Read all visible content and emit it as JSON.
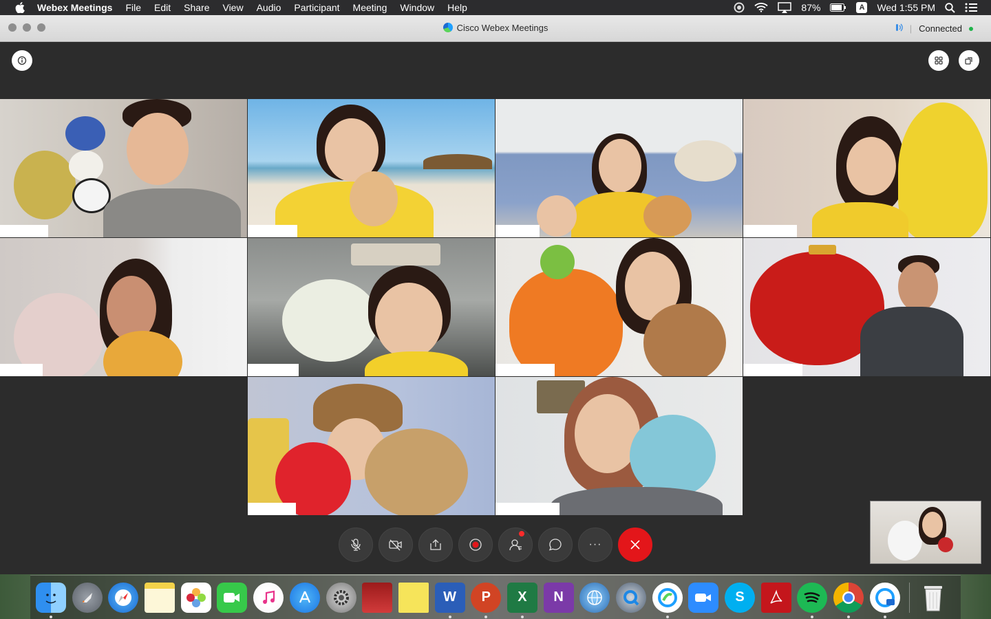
{
  "menubar": {
    "app_name": "Webex Meetings",
    "items": [
      "File",
      "Edit",
      "Share",
      "View",
      "Audio",
      "Participant",
      "Meeting",
      "Window",
      "Help"
    ],
    "battery": "87%",
    "input_source": "A",
    "clock": "Wed 1:55 PM"
  },
  "window": {
    "title": "Cisco Webex Meetings",
    "status": "Connected"
  },
  "icons": {
    "apple": "apple-icon",
    "info": "info-icon",
    "layout": "grid-layout-icon",
    "minimize": "restore-window-icon",
    "mute": "microphone-muted-icon",
    "video": "video-off-icon",
    "share": "share-screen-icon",
    "record": "record-icon",
    "participants": "participants-icon",
    "chat": "chat-icon",
    "more": "more-options-icon",
    "leave": "leave-meeting-icon"
  },
  "controls": {
    "more_glyph": "···"
  },
  "colors": {
    "end_button": "#e3161a",
    "connected_dot": "#1fb34a",
    "badge": "#ff2b2b"
  },
  "dock": {
    "apps": [
      "Finder",
      "Launchpad",
      "Safari",
      "Notes",
      "Photos",
      "FaceTime",
      "iTunes",
      "App Store",
      "System Preferences",
      "Photo Booth",
      "Stickies",
      "Word",
      "PowerPoint",
      "Excel",
      "OneNote",
      "Network Utility",
      "QuickTime",
      "Webex",
      "Zoom",
      "Skype",
      "Acrobat",
      "Spotify",
      "Chrome",
      "Webex Meetings",
      "Trash"
    ],
    "glyphs": {
      "word": "W",
      "powerpoint": "P",
      "excel": "X",
      "onenote": "N",
      "skype": "S"
    }
  }
}
